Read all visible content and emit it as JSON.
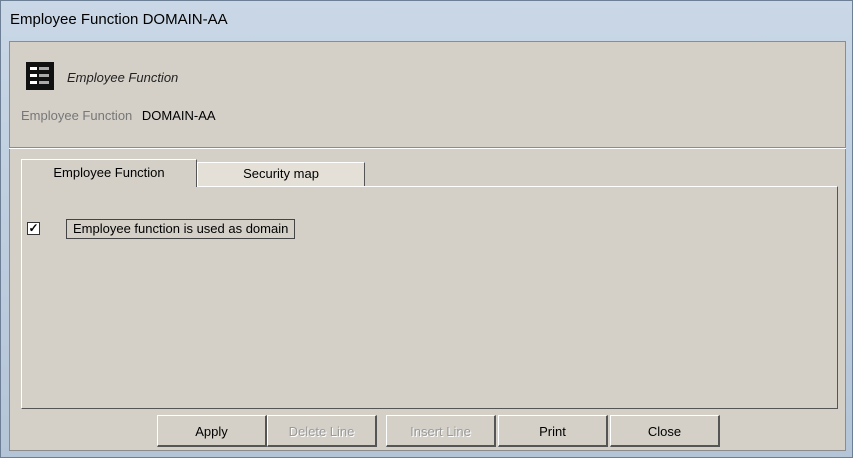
{
  "window": {
    "title": "Employee Function DOMAIN-AA"
  },
  "header": {
    "caption": "Employee Function",
    "field_label": "Employee Function",
    "field_value": "DOMAIN-AA"
  },
  "tabs": [
    {
      "label": "Employee Function",
      "active": true
    },
    {
      "label": "Security map",
      "active": false
    }
  ],
  "panel": {
    "checkbox": {
      "label": "Employee function is used as domain",
      "checked": true,
      "mark": "☑"
    }
  },
  "buttons": [
    {
      "label": "Apply",
      "enabled": true
    },
    {
      "label": "Delete Line",
      "enabled": false
    },
    {
      "label": "Insert Line",
      "enabled": false
    },
    {
      "label": "Print",
      "enabled": true
    },
    {
      "label": "Close",
      "enabled": true
    }
  ],
  "colors": {
    "titlebar": "#c9d7e6",
    "face": "#d4d0c8"
  }
}
